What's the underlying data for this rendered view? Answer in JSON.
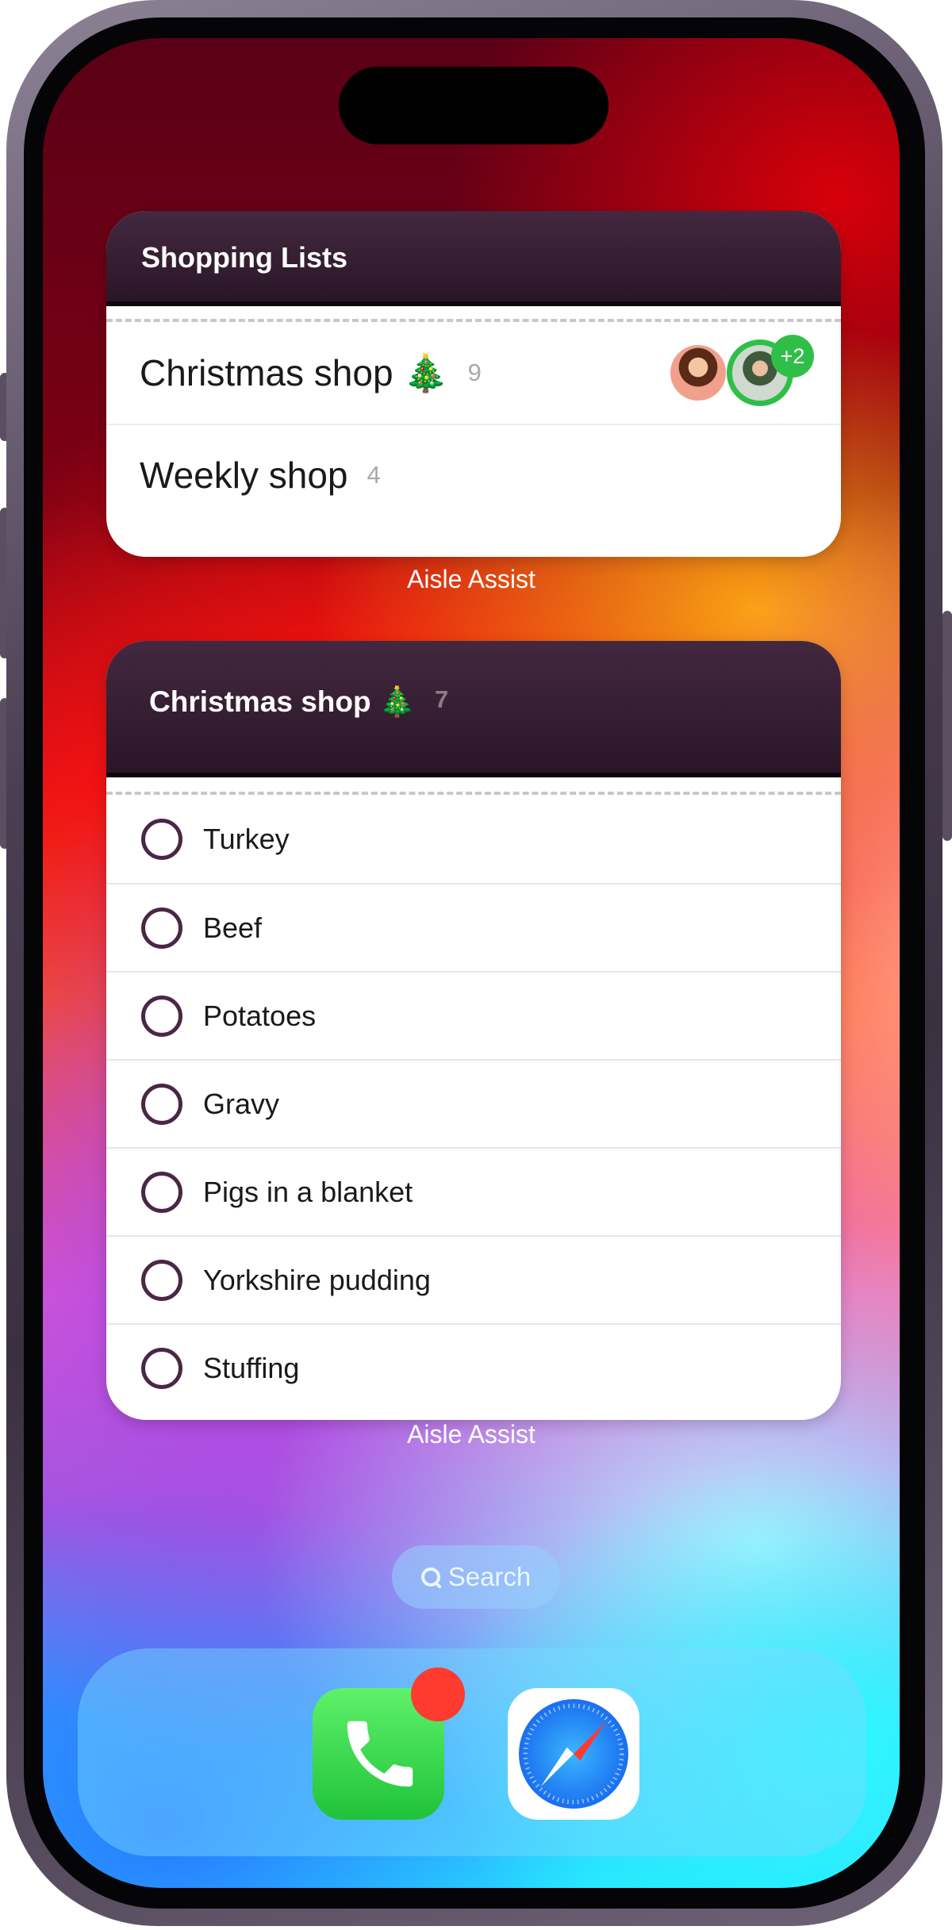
{
  "lists_widget": {
    "title": "Shopping Lists",
    "lists": [
      {
        "name": "Christmas shop 🎄",
        "count": "9",
        "collaborators_extra": "+2"
      },
      {
        "name": "Weekly shop",
        "count": "4"
      }
    ],
    "app_label": "Aisle Assist"
  },
  "list_widget": {
    "title": "Christmas shop 🎄",
    "count": "7",
    "items": [
      "Turkey",
      "Beef",
      "Potatoes",
      "Gravy",
      "Pigs in a blanket",
      "Yorkshire pudding",
      "Stuffing"
    ],
    "app_label": "Aisle Assist"
  },
  "search": {
    "label": "Search"
  },
  "dock": {
    "apps": [
      {
        "icon": "phone-icon",
        "has_badge": true
      },
      {
        "icon": "safari-compass-icon"
      }
    ]
  },
  "colors": {
    "widget_header": "#3a2036",
    "checkbox_ring": "#4a2745",
    "collaborator_ring": "#2fbf48",
    "notification_badge": "#ff3b30"
  }
}
